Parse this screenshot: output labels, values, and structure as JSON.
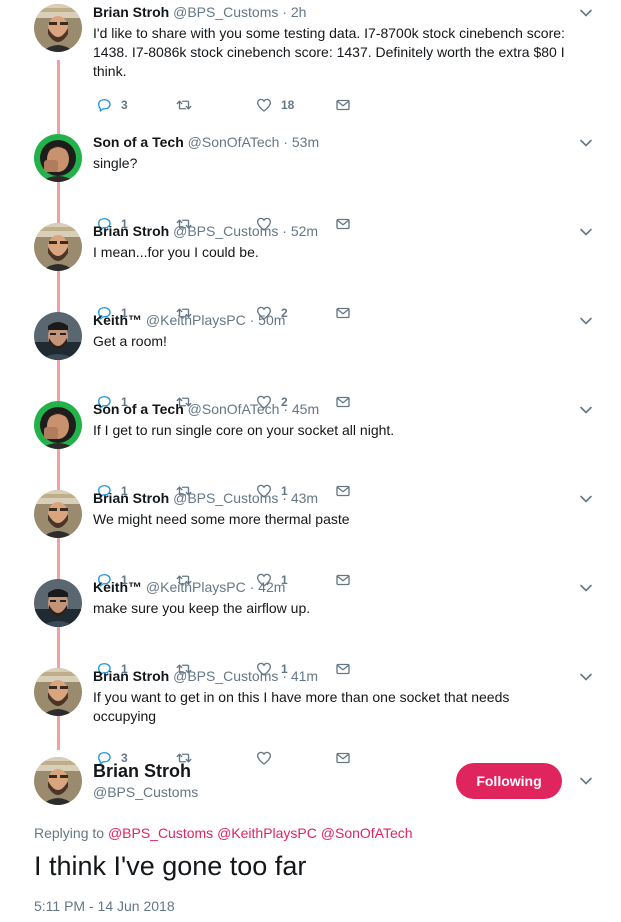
{
  "thread": [
    {
      "avatar": "brian",
      "name": "Brian Stroh",
      "handle": "@BPS_Customs",
      "sep": "·",
      "time": "2h",
      "text": "I'd like to share with you some testing data. I7-8700k stock cinebench score: 1438. I7-8086k stock cinebench score: 1437. Definitely worth the extra $80 I think.",
      "replies": "3",
      "retweets": "",
      "likes": "18"
    },
    {
      "avatar": "sonofatech",
      "name": "Son of a Tech",
      "handle": "@SonOfATech",
      "sep": "·",
      "time": "53m",
      "text": "single?",
      "replies": "1",
      "retweets": "",
      "likes": ""
    },
    {
      "avatar": "brian",
      "name": "Brian Stroh",
      "handle": "@BPS_Customs",
      "sep": "·",
      "time": "52m",
      "text": "I mean...for you I could be.",
      "replies": "1",
      "retweets": "",
      "likes": "2"
    },
    {
      "avatar": "keith",
      "name": "Keith™",
      "handle": "@KeithPlaysPC",
      "sep": "·",
      "time": "50m",
      "text": "Get a room!",
      "replies": "1",
      "retweets": "",
      "likes": "2"
    },
    {
      "avatar": "sonofatech",
      "name": "Son of a Tech",
      "handle": "@SonOfATech",
      "sep": "·",
      "time": "45m",
      "text": "If I get to run single core on your socket all night.",
      "replies": "1",
      "retweets": "",
      "likes": "1"
    },
    {
      "avatar": "brian",
      "name": "Brian Stroh",
      "handle": "@BPS_Customs",
      "sep": "·",
      "time": "43m",
      "text": "We might need some more thermal paste",
      "replies": "1",
      "retweets": "",
      "likes": "1"
    },
    {
      "avatar": "keith",
      "name": "Keith™",
      "handle": "@KeithPlaysPC",
      "sep": "·",
      "time": "42m",
      "text": "make sure you keep the airflow up.",
      "replies": "1",
      "retweets": "",
      "likes": "1"
    },
    {
      "avatar": "brian",
      "name": "Brian Stroh",
      "handle": "@BPS_Customs",
      "sep": "·",
      "time": "41m",
      "text": "If you want to get in on this I have more than one socket that needs occupying",
      "replies": "3",
      "retweets": "",
      "likes": ""
    }
  ],
  "main": {
    "name": "Brian Stroh",
    "handle": "@BPS_Customs",
    "follow_label": "Following",
    "replying_prefix": "Replying to",
    "mentions": [
      "@BPS_Customs",
      "@KeithPlaysPC",
      "@SonOfATech"
    ],
    "text": "I think I've gone too far",
    "timestamp": "5:11 PM - 14 Jun 2018"
  },
  "icons": {
    "reply": "reply-icon",
    "retweet": "retweet-icon",
    "like": "heart-icon",
    "dm": "envelope-icon",
    "menu": "chevron-down-icon"
  },
  "colors": {
    "thread_line": "#f49fa4",
    "accent": "#e0245e",
    "icon_blue": "#1b95e0",
    "icon_gray": "#657786"
  }
}
